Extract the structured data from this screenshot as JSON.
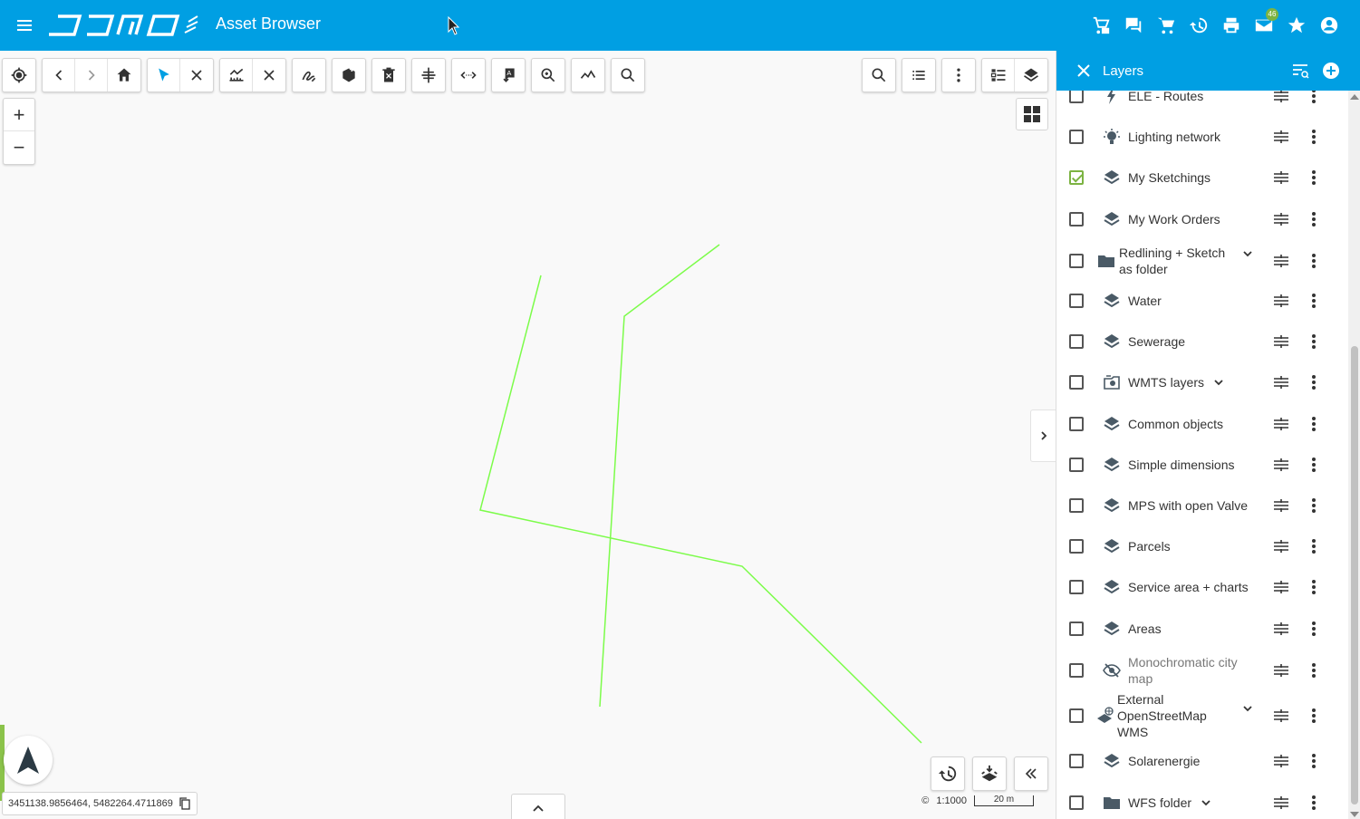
{
  "header": {
    "app_title": "Asset Browser",
    "logo_text": "SAMO",
    "mail_badge": "46",
    "icons": [
      "cart-list-icon",
      "chat-icon",
      "cart-icon",
      "history-icon",
      "print-icon",
      "mail-icon",
      "star-icon",
      "account-icon"
    ]
  },
  "map": {
    "coordinates": "3451138.9856464, 5482264.4711869",
    "scale": "1:1000",
    "scale_bar": "20 m",
    "copyright": "©",
    "line_color": "#7cfc4a"
  },
  "panel": {
    "title": "Layers",
    "layers": [
      {
        "name": "ELE - Routes",
        "icon": "bolt-icon",
        "checked": false
      },
      {
        "name": "Lighting network",
        "icon": "bulb-icon",
        "checked": false
      },
      {
        "name": "My Sketchings",
        "icon": "layers-icon",
        "checked": true
      },
      {
        "name": "My Work Orders",
        "icon": "layers-icon",
        "checked": false
      },
      {
        "name": "Redlining + Sketch as folder",
        "line1": "Redlining + Sketch",
        "line2": "as folder",
        "icon": "folder-icon",
        "checked": false
      },
      {
        "name": "Water",
        "icon": "layers-icon",
        "checked": false
      },
      {
        "name": "Sewerage",
        "icon": "layers-icon",
        "checked": false
      },
      {
        "name": "WMTS layers",
        "icon": "wmts-icon",
        "checked": false
      },
      {
        "name": "Common objects",
        "icon": "layers-icon",
        "checked": false
      },
      {
        "name": "Simple dimensions",
        "icon": "layers-icon",
        "checked": false
      },
      {
        "name": "MPS with open Valve",
        "icon": "layers-icon",
        "checked": false
      },
      {
        "name": "Parcels",
        "icon": "layers-icon",
        "checked": false
      },
      {
        "name": "Service area + charts",
        "icon": "layers-icon",
        "checked": false
      },
      {
        "name": "Areas",
        "icon": "layers-icon",
        "checked": false
      },
      {
        "name": "Monochromatic city map",
        "line1": "Monochromatic city",
        "line2": "map",
        "icon": "eye-off-icon",
        "checked": false
      },
      {
        "name": "External OpenStreetMap WMS",
        "line1": "External",
        "line2": "OpenStreetMap",
        "line3": "WMS",
        "icon": "globe-layers-icon",
        "checked": false
      },
      {
        "name": "Solarenergie",
        "icon": "layers-icon",
        "checked": false
      },
      {
        "name": "WFS folder",
        "icon": "folder-icon",
        "checked": false
      }
    ]
  },
  "colors": {
    "brand": "#009fe3",
    "check": "#7cb342"
  }
}
